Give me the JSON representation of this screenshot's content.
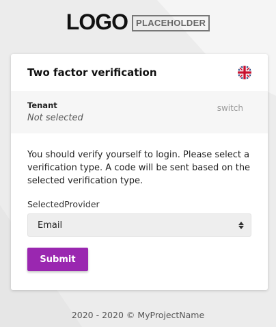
{
  "logo": {
    "text": "LOGO",
    "placeholder": "PLACEHOLDER"
  },
  "card": {
    "title": "Two factor verification",
    "language_icon": "uk-flag-icon",
    "tenant": {
      "label": "Tenant",
      "value": "Not selected",
      "switch_label": "switch"
    },
    "message": "You should verify yourself to login. Please select a verification type. A code will be sent based on the selected verification type.",
    "provider": {
      "label": "SelectedProvider",
      "selected": "Email"
    },
    "submit_label": "Submit"
  },
  "footer": {
    "text": "2020 - 2020 © MyProjectName"
  },
  "colors": {
    "accent": "#9a27b0",
    "background": "#ececec"
  }
}
